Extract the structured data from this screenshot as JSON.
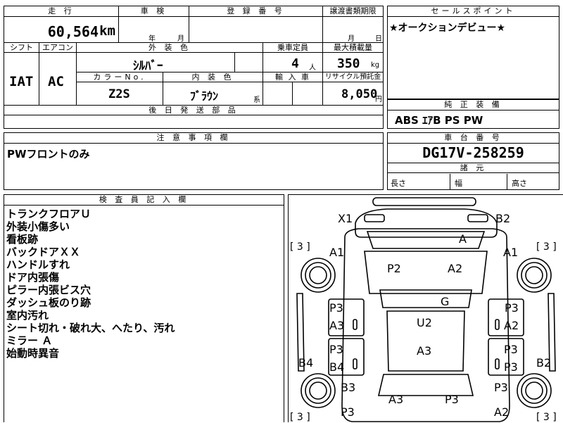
{
  "headers": {
    "mileage": "走 行",
    "inspection": "車 検",
    "registration": "登 録 番 号",
    "transfer": "譲渡書類期限",
    "sales_point": "セールスポイント",
    "shift": "シフト",
    "aircon": "エアコン",
    "exterior_color": "外 装 色",
    "capacity": "乗車定員",
    "max_load": "最大積載量",
    "color_no": "カラーNo.",
    "interior_color": "内 装 色",
    "import": "輸 入 車",
    "recycle": "リサイクル預託金",
    "later_parts": "後 日 発 送 部 品",
    "genuine_equipment": "純 正 装 備",
    "notes": "注 意 事 項 欄",
    "chassis_no": "車 台 番 号",
    "dimensions": "諸 元",
    "inspector_notes": "検 査 員 記 入 欄"
  },
  "vehicle": {
    "mileage": "60,564",
    "mileage_unit": "km",
    "inspection_year_unit": "年",
    "inspection_month_unit": "月",
    "transfer_month_unit": "月",
    "transfer_day_unit": "日",
    "shift": "IAT",
    "aircon": "AC",
    "exterior_color": "ｼﾙﾊﾞｰ",
    "capacity": "4",
    "capacity_unit": "人",
    "max_load": "350",
    "max_load_unit": "kg",
    "color_no": "Z2S",
    "interior_color": "ﾌﾞﾗｳﾝ",
    "interior_color_suffix": "系",
    "recycle_fee": "8,050",
    "recycle_unit": "円",
    "sales_point": "★オークションデビュー★",
    "genuine_equipment": "ABS ｴｱB PS PW",
    "notes": "PWフロントのみ",
    "chassis_no": "DG17V-258259",
    "length_label": "長さ",
    "width_label": "幅",
    "height_label": "高さ"
  },
  "inspector_notes": [
    "トランクフロアＵ",
    "外装小傷多い",
    "看板跡",
    "バックドアＸＸ",
    "ハンドルすれ",
    "ドア内張傷",
    "ピラー内張ビス穴",
    "ダッシュ板のり跡",
    "室内汚れ",
    "シート切れ・破れ大、へたり、汚れ",
    "ミラー Ａ",
    "始動時異音"
  ],
  "diagram_marks": {
    "x1": "X1",
    "b2_top": "B2",
    "a_hood": "A",
    "tire_fl": "[ 3 ]",
    "tire_fr": "[ 3 ]",
    "tire_rl": "[ 3 ]",
    "tire_rr": "[ 3 ]",
    "a1_left": "A1",
    "a1_right": "A1",
    "p2": "P2",
    "a2_front": "A2",
    "g": "G",
    "p3_left_top": "P3",
    "a3_left": "A3",
    "p3_right_top": "P3",
    "a2_right": "A2",
    "u2": "U2",
    "a3_center": "A3",
    "p3_left_mid": "P3",
    "b4_left": "B4",
    "p3_right_mid": "P3",
    "p3_right_mid2": "P3",
    "b4_side": "B4",
    "b2_side": "B2",
    "b3_left": "B3",
    "p3_right_low": "P3",
    "a3_rear": "A3",
    "p3_rear": "P3",
    "p3_left_bottom": "P3",
    "a2_right_bottom": "A2"
  }
}
